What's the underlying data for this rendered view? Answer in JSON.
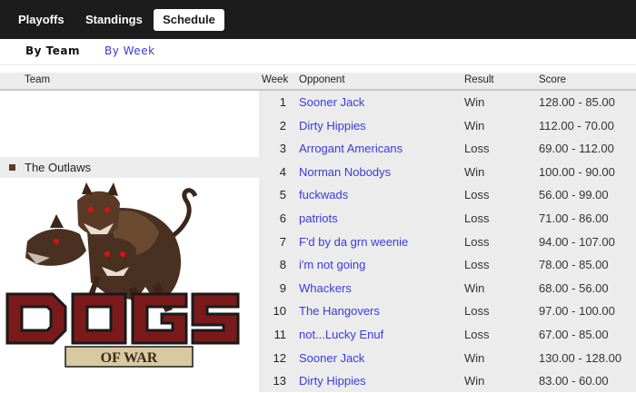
{
  "nav": {
    "tabs": [
      "Playoffs",
      "Standings",
      "Schedule"
    ],
    "active": "Schedule"
  },
  "subnav": {
    "tabs": [
      "By Team",
      "By Week"
    ],
    "active": "By Team"
  },
  "columns": {
    "team": "Team",
    "week": "Week",
    "opponent": "Opponent",
    "result": "Result",
    "score": "Score"
  },
  "team": {
    "name": "The Outlaws"
  },
  "colors": {
    "topbar": "#1c1c1c",
    "link": "#3a3adf",
    "row_bg": "#ececec"
  },
  "schedule": [
    {
      "week": "1",
      "opponent": "Sooner Jack",
      "result": "Win",
      "score": "128.00 - 85.00"
    },
    {
      "week": "2",
      "opponent": "Dirty Hippies",
      "result": "Win",
      "score": "112.00 - 70.00"
    },
    {
      "week": "3",
      "opponent": "Arrogant Americans",
      "result": "Loss",
      "score": "69.00 - 112.00"
    },
    {
      "week": "4",
      "opponent": "Norman Nobodys",
      "result": "Win",
      "score": "100.00 - 90.00"
    },
    {
      "week": "5",
      "opponent": "fuckwads",
      "result": "Loss",
      "score": "56.00 - 99.00"
    },
    {
      "week": "6",
      "opponent": "patriots",
      "result": "Loss",
      "score": "71.00 - 86.00"
    },
    {
      "week": "7",
      "opponent": "F'd by da grn weenie",
      "result": "Loss",
      "score": "94.00 - 107.00"
    },
    {
      "week": "8",
      "opponent": "i'm not going",
      "result": "Loss",
      "score": "78.00 - 85.00"
    },
    {
      "week": "9",
      "opponent": "Whackers",
      "result": "Win",
      "score": "68.00 - 56.00"
    },
    {
      "week": "10",
      "opponent": "The Hangovers",
      "result": "Loss",
      "score": "97.00 - 100.00"
    },
    {
      "week": "11",
      "opponent": "not...Lucky Enuf",
      "result": "Loss",
      "score": "67.00 - 85.00"
    },
    {
      "week": "12",
      "opponent": "Sooner Jack",
      "result": "Win",
      "score": "130.00 - 128.00"
    },
    {
      "week": "13",
      "opponent": "Dirty Hippies",
      "result": "Win",
      "score": "83.00 - 60.00"
    }
  ]
}
